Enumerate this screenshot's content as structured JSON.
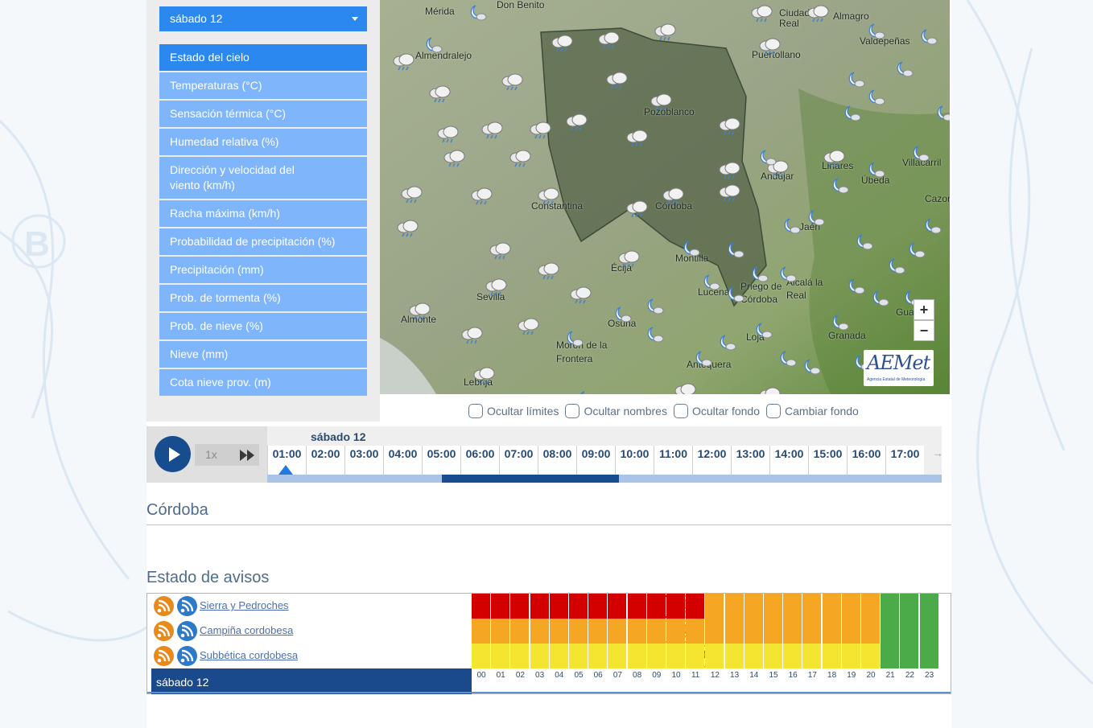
{
  "day_selector": {
    "value": "sábado 12"
  },
  "layers": [
    {
      "label": "Estado del cielo",
      "active": true
    },
    {
      "label": "Temperaturas (°C)",
      "active": false
    },
    {
      "label": "Sensación térmica (°C)",
      "active": false
    },
    {
      "label": "Humedad relativa (%)",
      "active": false
    },
    {
      "label": "Dirección y velocidad del viento (km/h)",
      "active": false
    },
    {
      "label": "Racha máxima (km/h)",
      "active": false
    },
    {
      "label": "Probabilidad de precipitación (%)",
      "active": false
    },
    {
      "label": "Precipitación (mm)",
      "active": false
    },
    {
      "label": "Prob. de tormenta (%)",
      "active": false
    },
    {
      "label": "Prob. de nieve (%)",
      "active": false
    },
    {
      "label": "Nieve (mm)",
      "active": false
    },
    {
      "label": "Cota nieve prov. (m)",
      "active": false
    }
  ],
  "map": {
    "cities": [
      "Mérida",
      "Don Benito",
      "Ciudad Real",
      "Almagro",
      "Valdepeñas",
      "Almendralejo",
      "Puertollano",
      "Pozoblanco",
      "Andújar",
      "Linares",
      "Úbeda",
      "Villacarril",
      "Cazor",
      "Constantina",
      "Córdoba",
      "Jaén",
      "Écija",
      "Montilla",
      "Sevilla",
      "Lucena",
      "Priego de Córdoba",
      "Alcalá la Real",
      "Almonte",
      "Osuna",
      "Gua",
      "Morón de la Frontera",
      "Loja",
      "Granada",
      "Antequera",
      "Lebrija"
    ],
    "zoom_in": "+",
    "zoom_out": "−",
    "logo": "AEMet",
    "logo_subtitle": "Agencia Estatal de Meteorología"
  },
  "map_options": [
    "Ocultar límites",
    "Ocultar nombres",
    "Ocultar fondo",
    "Cambiar fondo"
  ],
  "player": {
    "speed": "1x",
    "day": "sábado 12",
    "hours": [
      "01:00",
      "02:00",
      "03:00",
      "04:00",
      "05:00",
      "06:00",
      "07:00",
      "08:00",
      "09:00",
      "10:00",
      "11:00",
      "12:00",
      "13:00",
      "14:00",
      "15:00",
      "16:00",
      "17:00"
    ],
    "prev_arrow": "<",
    "next_arrow": "→"
  },
  "location_title": "Córdoba",
  "warnings": {
    "title": "Estado de avisos",
    "day_label": "sábado 12",
    "hour_labels": [
      "00",
      "01",
      "02",
      "03",
      "04",
      "05",
      "06",
      "07",
      "08",
      "09",
      "10",
      "11",
      "12",
      "13",
      "14",
      "15",
      "16",
      "17",
      "18",
      "19",
      "20",
      "21",
      "22",
      "23"
    ],
    "colors": {
      "red": "#d40000",
      "orange": "#f5a623",
      "yellow": "#f3e530",
      "green": "#4bab49"
    },
    "zones": [
      {
        "name": "Sierra y Pedroches",
        "icons": [
          "rain-red",
          "storm-yellow"
        ],
        "hours": [
          "red",
          "red",
          "red",
          "red",
          "red",
          "red",
          "red",
          "red",
          "red",
          "red",
          "red",
          "red",
          "orange",
          "orange",
          "orange",
          "orange",
          "orange",
          "orange",
          "orange",
          "orange",
          "orange",
          "green",
          "green",
          "green"
        ]
      },
      {
        "name": "Campiña cordobesa",
        "icons": [
          "rain-yellow",
          "storm-yellow"
        ],
        "hours": [
          "orange",
          "orange",
          "orange",
          "orange",
          "orange",
          "orange",
          "orange",
          "orange",
          "orange",
          "orange",
          "orange",
          "orange",
          "orange",
          "orange",
          "orange",
          "orange",
          "orange",
          "orange",
          "orange",
          "orange",
          "orange",
          "green",
          "green",
          "green"
        ]
      },
      {
        "name": "Subbética cordobesa",
        "icons": [
          "rain-yellow"
        ],
        "hours": [
          "yellow",
          "yellow",
          "yellow",
          "yellow",
          "yellow",
          "yellow",
          "yellow",
          "yellow",
          "yellow",
          "yellow",
          "yellow",
          "yellow",
          "yellow",
          "yellow",
          "yellow",
          "yellow",
          "yellow",
          "yellow",
          "yellow",
          "yellow",
          "yellow",
          "green",
          "green",
          "green"
        ]
      }
    ]
  }
}
